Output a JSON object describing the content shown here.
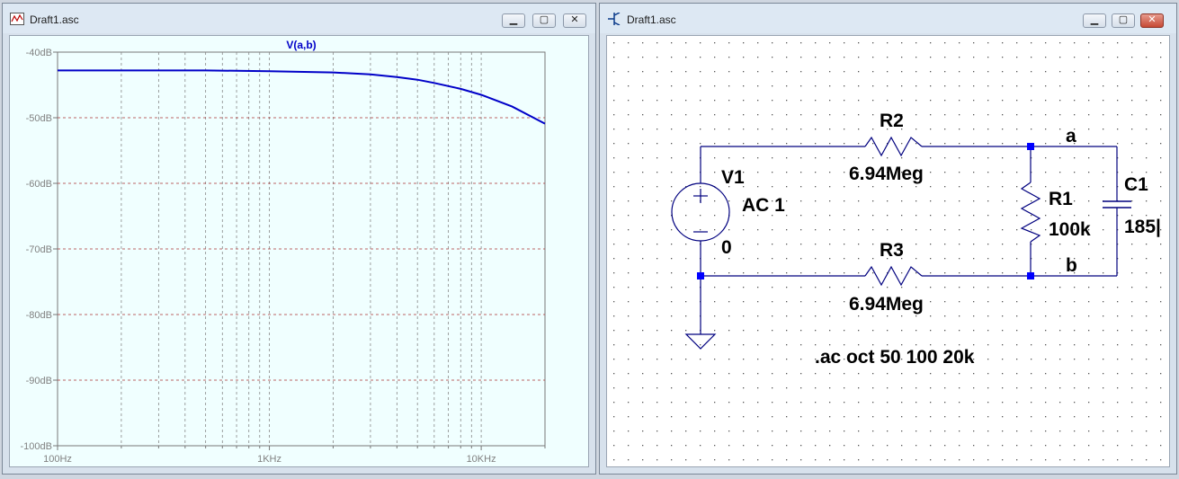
{
  "left_window": {
    "title": "Draft1.asc",
    "icon": "waveform-plot-icon",
    "controls": {
      "minimize": "▁",
      "restore": "▢",
      "close": "✕"
    }
  },
  "right_window": {
    "title": "Draft1.asc",
    "icon": "schematic-icon",
    "controls": {
      "minimize": "▁",
      "restore": "▢",
      "close": "✕"
    }
  },
  "chart_data": {
    "type": "line",
    "title": "V(a,b)",
    "xlabel": "",
    "ylabel": "",
    "x_scale": "log",
    "x_range_hz": [
      100,
      20000
    ],
    "x_tick_labels": [
      "100Hz",
      "1KHz",
      "10KHz"
    ],
    "x_tick_values": [
      100,
      1000,
      10000
    ],
    "ylim": [
      -100,
      -40
    ],
    "y_tick_labels": [
      "-40dB",
      "-50dB",
      "-60dB",
      "-70dB",
      "-80dB",
      "-90dB",
      "-100dB"
    ],
    "y_tick_values": [
      -40,
      -50,
      -60,
      -70,
      -80,
      -90,
      -100
    ],
    "grid": true,
    "series": [
      {
        "color": "#0000c8",
        "x": [
          100,
          200,
          500,
          1000,
          2000,
          3000,
          4000,
          5000,
          6000,
          8000,
          10000,
          14000,
          20000
        ],
        "values": [
          -42.8,
          -42.8,
          -42.8,
          -42.9,
          -43.1,
          -43.4,
          -43.8,
          -44.2,
          -44.7,
          -45.6,
          -46.5,
          -48.3,
          -50.9
        ]
      }
    ]
  },
  "schematic": {
    "components": {
      "v1": {
        "name": "V1",
        "value": "AC 1"
      },
      "r2": {
        "name": "R2",
        "value": "6.94Meg"
      },
      "r3": {
        "name": "R3",
        "value": "6.94Meg"
      },
      "r1": {
        "name": "R1",
        "value": "100k"
      },
      "c1": {
        "name": "C1",
        "value": "185|"
      }
    },
    "nodes": {
      "a": "a",
      "b": "b",
      "ground": "0"
    },
    "directive": ".ac oct 50 100 20k",
    "wire_color": "#00007f",
    "junction_color": "#0000ff"
  }
}
